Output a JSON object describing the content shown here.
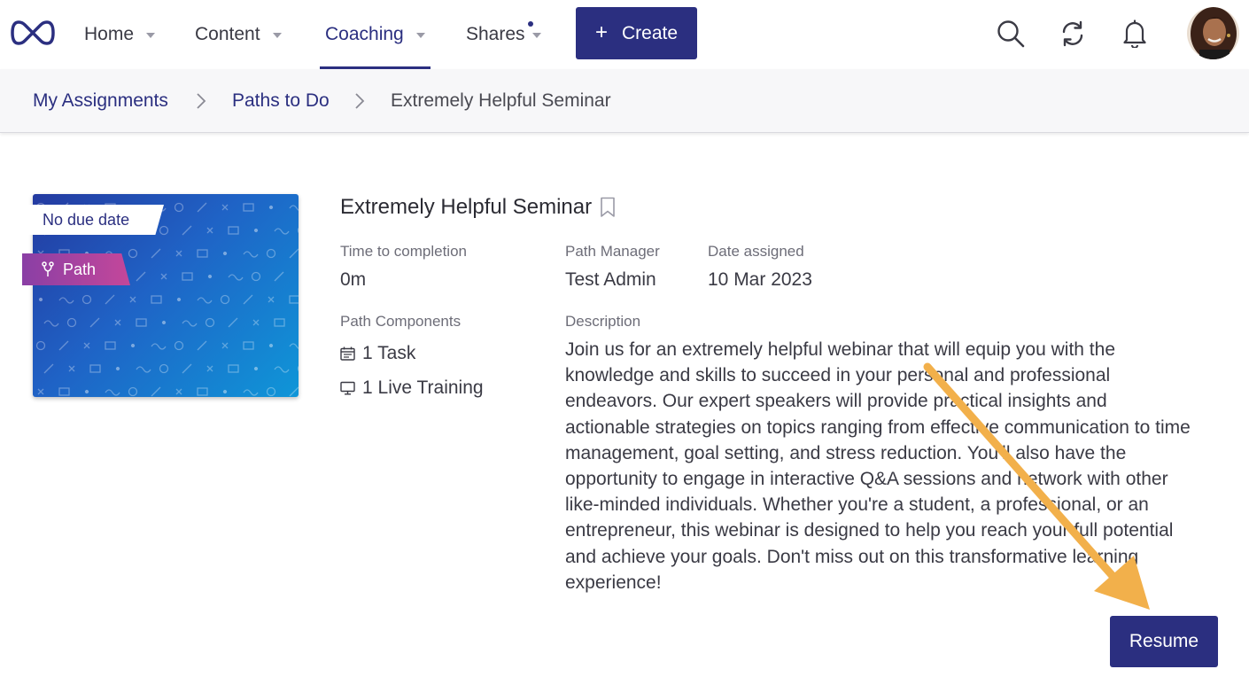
{
  "nav": {
    "home": "Home",
    "content": "Content",
    "coaching": "Coaching",
    "shares": "Shares",
    "create": "Create"
  },
  "breadcrumb": {
    "level1": "My Assignments",
    "level2": "Paths to Do",
    "current": "Extremely Helpful Seminar"
  },
  "card": {
    "due_badge": "No due date",
    "type_badge": "Path",
    "title": "Extremely Helpful Seminar",
    "time_label": "Time to completion",
    "time_value": "0m",
    "manager_label": "Path Manager",
    "manager_value": "Test Admin",
    "assigned_label": "Date assigned",
    "assigned_value": "10 Mar 2023",
    "components_label": "Path Components",
    "components": [
      "1 Task",
      "1 Live Training"
    ],
    "description_label": "Description",
    "description": "Join us for an extremely helpful webinar that will equip you with the knowledge and skills to succeed in your personal and professional endeavors. Our expert speakers will provide practical insights and actionable strategies on topics ranging from effective communication to time management, goal setting, and stress reduction. You'll also have the opportunity to engage in interactive Q&A sessions and network with other like-minded individuals. Whether you're a student, a professional, or an entrepreneur, this webinar is designed to help you reach your full potential and achieve your goals. Don't miss out on this transformative learning experience!",
    "resume": "Resume"
  },
  "colors": {
    "brand": "#2b2f80",
    "annotation_arrow": "#f2b04b"
  },
  "icons": [
    "infinity-logo-icon",
    "search-icon",
    "sync-icon",
    "bell-icon",
    "path-fork-icon",
    "bookmark-icon",
    "calendar-task-icon",
    "monitor-icon",
    "chevron-right-icon"
  ]
}
